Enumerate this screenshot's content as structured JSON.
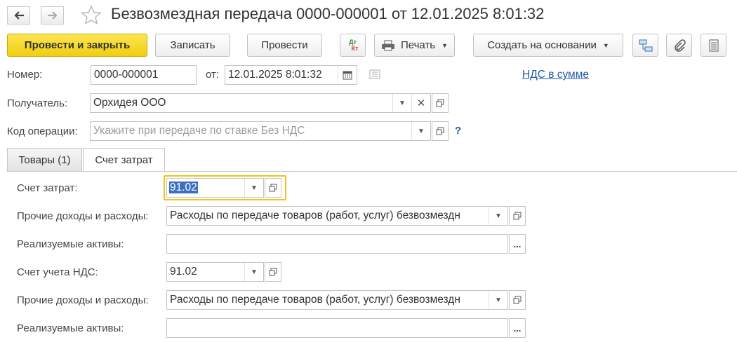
{
  "window": {
    "title": "Безвозмездная передача 0000-000001 от 12.01.2025 8:01:32"
  },
  "toolbar": {
    "post_close_label": "Провести и закрыть",
    "save_label": "Записать",
    "post_label": "Провести",
    "dt_kt_top": "Дт",
    "dt_kt_bottom": "Кт",
    "print_label": "Печать",
    "create_based_label": "Создать на основании"
  },
  "header": {
    "number_label": "Номер:",
    "number_value": "0000-000001",
    "date_label": "от:",
    "date_value": "12.01.2025  8:01:32",
    "vat_link": "НДС в сумме",
    "recipient_label": "Получатель:",
    "recipient_value": "Орхидея ООО",
    "op_code_label": "Код операции:",
    "op_code_placeholder": "Укажите при передаче по ставке Без НДС",
    "help_mark": "?"
  },
  "tabs": [
    {
      "label": "Товары (1)",
      "active": false
    },
    {
      "label": "Счет затрат",
      "active": true
    }
  ],
  "cost_tab": {
    "cost_account_label": "Счет затрат:",
    "cost_account_value": "91.02",
    "other_income_label_1": "Прочие доходы и расходы:",
    "other_income_value_1": "Расходы по передаче товаров (работ, услуг) безвозмездн",
    "assets_label_1": "Реализуемые активы:",
    "assets_value_1": "",
    "vat_account_label": "Счет учета НДС:",
    "vat_account_value": "91.02",
    "other_income_label_2": "Прочие доходы и расходы:",
    "other_income_value_2": "Расходы по передаче товаров (работ, услуг) безвозмездн",
    "assets_label_2": "Реализуемые активы:",
    "assets_value_2": "",
    "select_button": "..."
  },
  "colors": {
    "primary_button": "#f5d31b",
    "link": "#1f5aa6",
    "focus_border": "#f0c419",
    "selection": "#3e6fc1"
  },
  "icons": [
    "back-arrow-icon",
    "forward-arrow-icon",
    "star-icon",
    "dt-kt-icon",
    "printer-icon",
    "structure-icon",
    "paperclip-icon",
    "menu-icon",
    "calendar-icon",
    "document-list-icon",
    "dropdown-arrow-icon",
    "clear-icon",
    "open-icon"
  ]
}
